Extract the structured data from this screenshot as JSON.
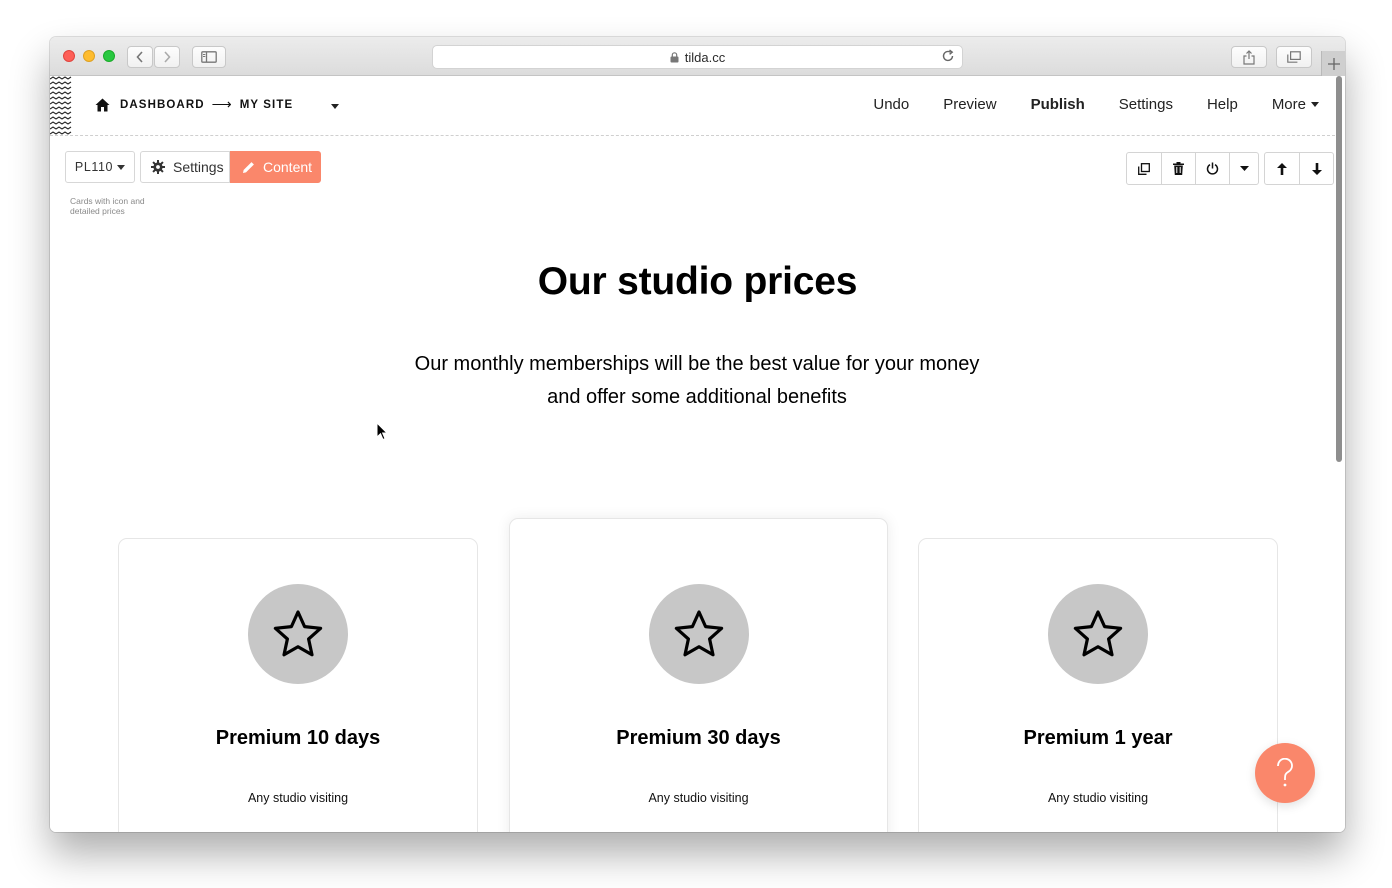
{
  "browser": {
    "url": "tilda.cc",
    "icons": [
      "back-arrow-icon",
      "forward-arrow-icon",
      "sidebar-icon",
      "lock-icon",
      "reload-icon",
      "share-icon",
      "tabs-icon",
      "plus-icon"
    ]
  },
  "nav": {
    "breadcrumb_home": "DASHBOARD",
    "breadcrumb_arrow": "⟶",
    "breadcrumb_site": "MY SITE",
    "undo": "Undo",
    "preview": "Preview",
    "publish": "Publish",
    "settings": "Settings",
    "help": "Help",
    "more": "More"
  },
  "block": {
    "code": "PL110",
    "settings_label": "Settings",
    "content_label": "Content",
    "description": "Cards with icon and detailed prices"
  },
  "hero": {
    "title": "Our studio prices",
    "subtitle": "Our monthly memberships will be the best value for your money and offer some additional benefits"
  },
  "cards": [
    {
      "title": "Premium 10 days",
      "feature": "Any studio visiting"
    },
    {
      "title": "Premium 30 days",
      "feature": "Any studio visiting"
    },
    {
      "title": "Premium 1 year",
      "feature": "Any studio visiting"
    }
  ],
  "colors": {
    "accent": "#fa876b",
    "icon_circle": "#c7c7c7"
  }
}
